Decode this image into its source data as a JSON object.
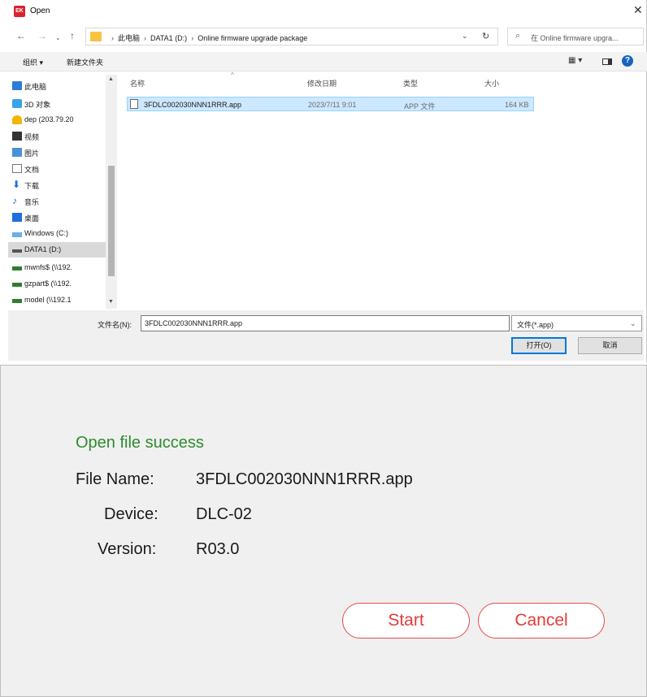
{
  "dialog": {
    "title": "Open",
    "app_icon_text": "EK"
  },
  "address": {
    "crumbs": [
      "此电脑",
      "DATA1 (D:)",
      "Online firmware upgrade package"
    ],
    "search_placeholder": "在 Online firmware upgra..."
  },
  "toolbar": {
    "organize_label": "组织 ▾",
    "new_folder_label": "新建文件夹"
  },
  "tree": {
    "items": [
      {
        "label": "此电脑",
        "icon": "computer-icon"
      },
      {
        "label": "3D 对象",
        "icon": "3d-objects-icon"
      },
      {
        "label": "dep (203.79.20",
        "icon": "user-folder-icon"
      },
      {
        "label": "视频",
        "icon": "video-icon"
      },
      {
        "label": "图片",
        "icon": "pictures-icon"
      },
      {
        "label": "文档",
        "icon": "documents-icon"
      },
      {
        "label": "下载",
        "icon": "download-icon"
      },
      {
        "label": "音乐",
        "icon": "music-icon"
      },
      {
        "label": "桌面",
        "icon": "desktop-icon"
      },
      {
        "label": "Windows (C:)",
        "icon": "windows-drive-icon"
      },
      {
        "label": "DATA1 (D:)",
        "icon": "drive-icon"
      },
      {
        "label": "mwnfs$ (\\\\192.",
        "icon": "network-drive-icon"
      },
      {
        "label": "gzpart$ (\\\\192.",
        "icon": "network-drive-icon"
      },
      {
        "label": "model (\\\\192.1",
        "icon": "network-drive-icon"
      }
    ],
    "selected_index": 10
  },
  "list": {
    "columns": {
      "name": "名称",
      "modified": "修改日期",
      "type": "类型",
      "size": "大小"
    },
    "files": [
      {
        "name": "3FDLC002030NNN1RRR.app",
        "modified": "2023/7/11 9:01",
        "type": "APP 文件",
        "size": "164 KB"
      }
    ]
  },
  "footer": {
    "filename_label": "文件名(N):",
    "filename_value": "3FDLC002030NNN1RRR.app",
    "filter_value": "文件(*.app)",
    "open_label": "打开(O)",
    "cancel_label": "取消"
  },
  "panel": {
    "status": "Open file success",
    "file_name_label": "File Name:",
    "file_name_value": "3FDLC002030NNN1RRR.app",
    "device_label": "Device:",
    "device_value": "DLC-02",
    "version_label": "Version:",
    "version_value": "R03.0",
    "start_label": "Start",
    "cancel_label": "Cancel"
  },
  "colors": {
    "accent": "#0078d7",
    "success": "#2e8b2e",
    "danger": "#e03c3c",
    "selection": "#cce8ff"
  }
}
